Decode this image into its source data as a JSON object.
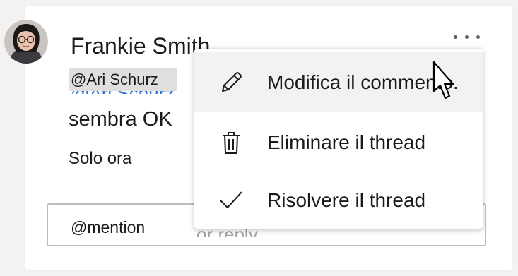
{
  "comment": {
    "author": "Frankie Smith",
    "mention": "@Ari Schurz",
    "mention_ghost": "@Ari Schurz",
    "body": "sembra OK",
    "timestamp": "Solo ora",
    "avatar_icon": "user-photo-avatar"
  },
  "more_button": {
    "icon": "more-horizontal-icon"
  },
  "context_menu": {
    "items": [
      {
        "icon": "pencil-icon",
        "label": "Modifica il commento."
      },
      {
        "icon": "trash-icon",
        "label": "Eliminare il thread"
      },
      {
        "icon": "checkmark-icon",
        "label": "Risolvere il thread"
      }
    ],
    "hovered_index": 0
  },
  "reply": {
    "prefix": "@mention",
    "placeholder_ghost": "or reply..."
  },
  "colors": {
    "mention_link": "#2f6fd6",
    "chip_background": "#e1dfdd",
    "hover_background": "#f3f2f1"
  }
}
